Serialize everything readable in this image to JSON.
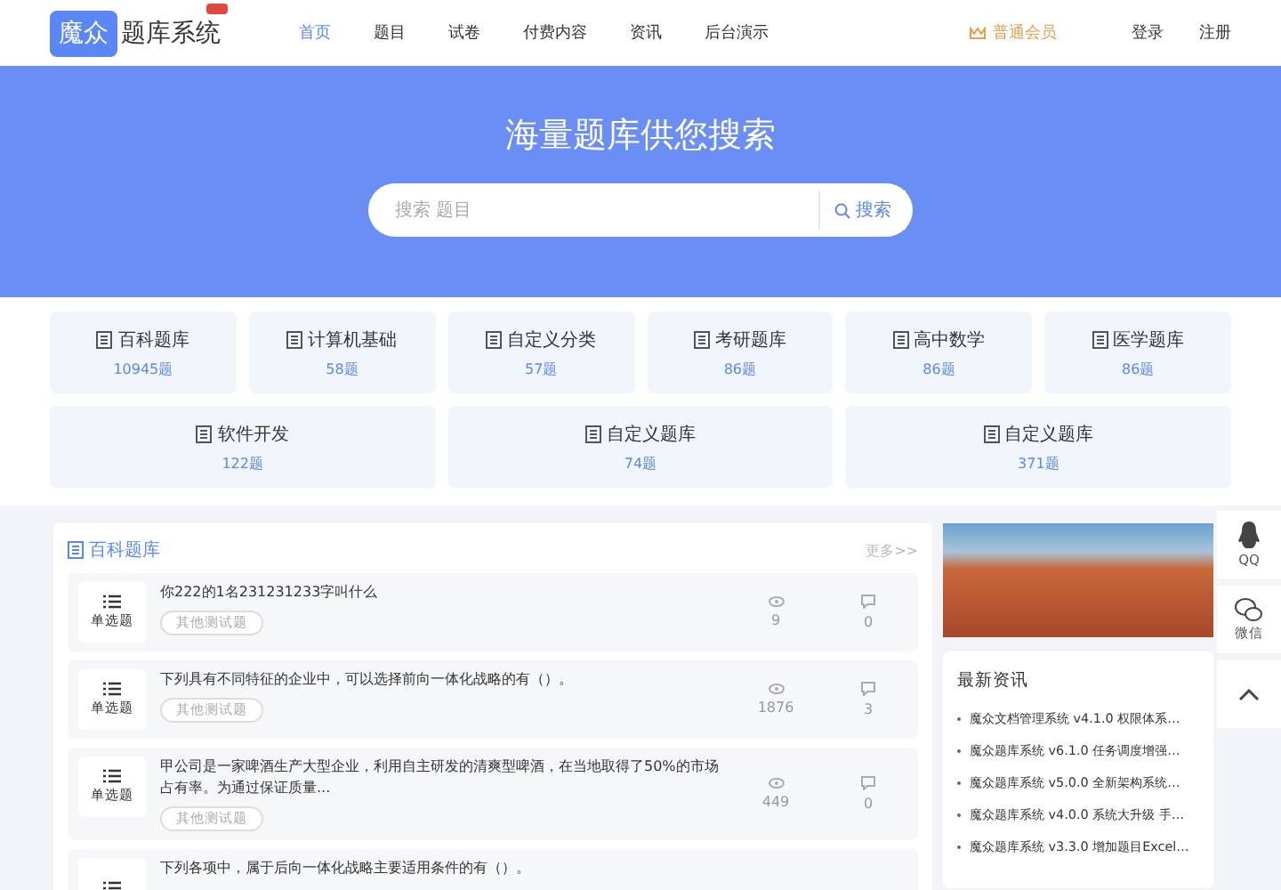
{
  "header": {
    "logo_mark": "魔众",
    "logo_text": "题库系统",
    "nav": [
      {
        "label": "首页",
        "selected": true
      },
      {
        "label": "题目",
        "selected": false
      },
      {
        "label": "试卷",
        "selected": false
      },
      {
        "label": "付费内容",
        "selected": false
      },
      {
        "label": "资讯",
        "selected": false
      },
      {
        "label": "后台演示",
        "selected": false
      }
    ],
    "member": "普通会员",
    "login": "登录",
    "register": "注册"
  },
  "hero": {
    "title": "海量题库供您搜索",
    "search": {
      "placeholder": "搜索 题目",
      "button": "搜索"
    }
  },
  "categories": [
    {
      "name": "百科题库",
      "count": "10945题"
    },
    {
      "name": "计算机基础",
      "count": "58题"
    },
    {
      "name": "自定义分类",
      "count": "57题"
    },
    {
      "name": "考研题库",
      "count": "86题"
    },
    {
      "name": "高中数学",
      "count": "86题"
    },
    {
      "name": "医学题库",
      "count": "86题"
    },
    {
      "name": "软件开发",
      "count": "122题"
    },
    {
      "name": "自定义题库",
      "count": "74题"
    },
    {
      "name": "自定义题库",
      "count": "371题"
    }
  ],
  "question_panel": {
    "title": "百科题库",
    "more": "更多>>",
    "questions": [
      {
        "type": "单选题",
        "title": "你222的1名231231233字叫什么",
        "tag": "其他测试题",
        "views": "9",
        "comments": "0"
      },
      {
        "type": "单选题",
        "title": "下列具有不同特征的企业中，可以选择前向一体化战略的有（）。",
        "tag": "其他测试题",
        "views": "1876",
        "comments": "3"
      },
      {
        "type": "单选题",
        "title": "甲公司是一家啤酒生产大型企业，利用自主研发的清爽型啤酒，在当地取得了50%的市场占有率。为通过保证质量...",
        "tag": "其他测试题",
        "views": "449",
        "comments": "0"
      },
      {
        "title": "下列各项中，属于后向一体化战略主要适用条件的有（）。"
      }
    ]
  },
  "news": {
    "title": "最新资讯",
    "items": [
      "魔众文档管理系统 v4.1.0 权限体系…",
      "魔众题库系统 v6.1.0 任务调度增强…",
      "魔众题库系统 v5.0.0 全新架构系统…",
      "魔众题库系统 v4.0.0 系统大升级 手…",
      "魔众题库系统 v3.3.0 增加题目Excel…"
    ]
  },
  "float_bar": [
    {
      "kind": "qq",
      "label": "QQ"
    },
    {
      "kind": "wechat",
      "label": "微信"
    },
    {
      "kind": "top"
    }
  ]
}
